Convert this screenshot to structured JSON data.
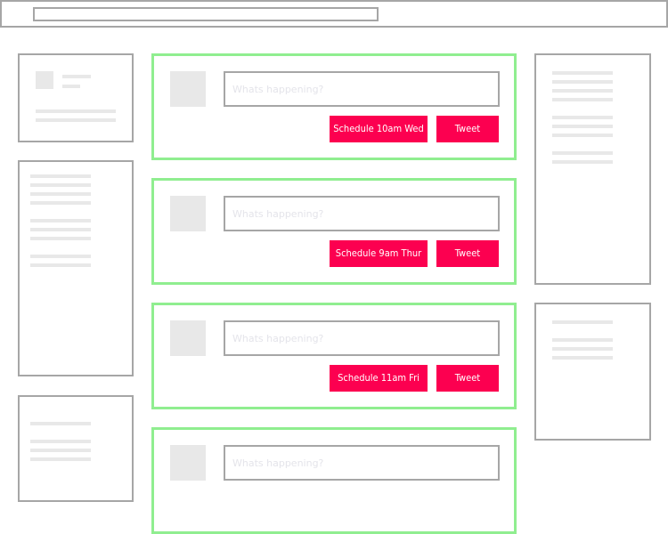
{
  "composers": [
    {
      "placeholder": "Whats happening?",
      "schedule_label": "Schedule 10am Wed",
      "tweet_label": "Tweet"
    },
    {
      "placeholder": "Whats happening?",
      "schedule_label": "Schedule 9am Thur",
      "tweet_label": "Tweet"
    },
    {
      "placeholder": "Whats happening?",
      "schedule_label": "Schedule 11am Fri",
      "tweet_label": "Tweet"
    },
    {
      "placeholder": "Whats happening?"
    }
  ],
  "colors": {
    "accent_button": "#fc0050",
    "composer_border": "#90ee90",
    "wireframe_border": "#a6a6a6",
    "placeholder_fill": "#e8e8e8"
  }
}
